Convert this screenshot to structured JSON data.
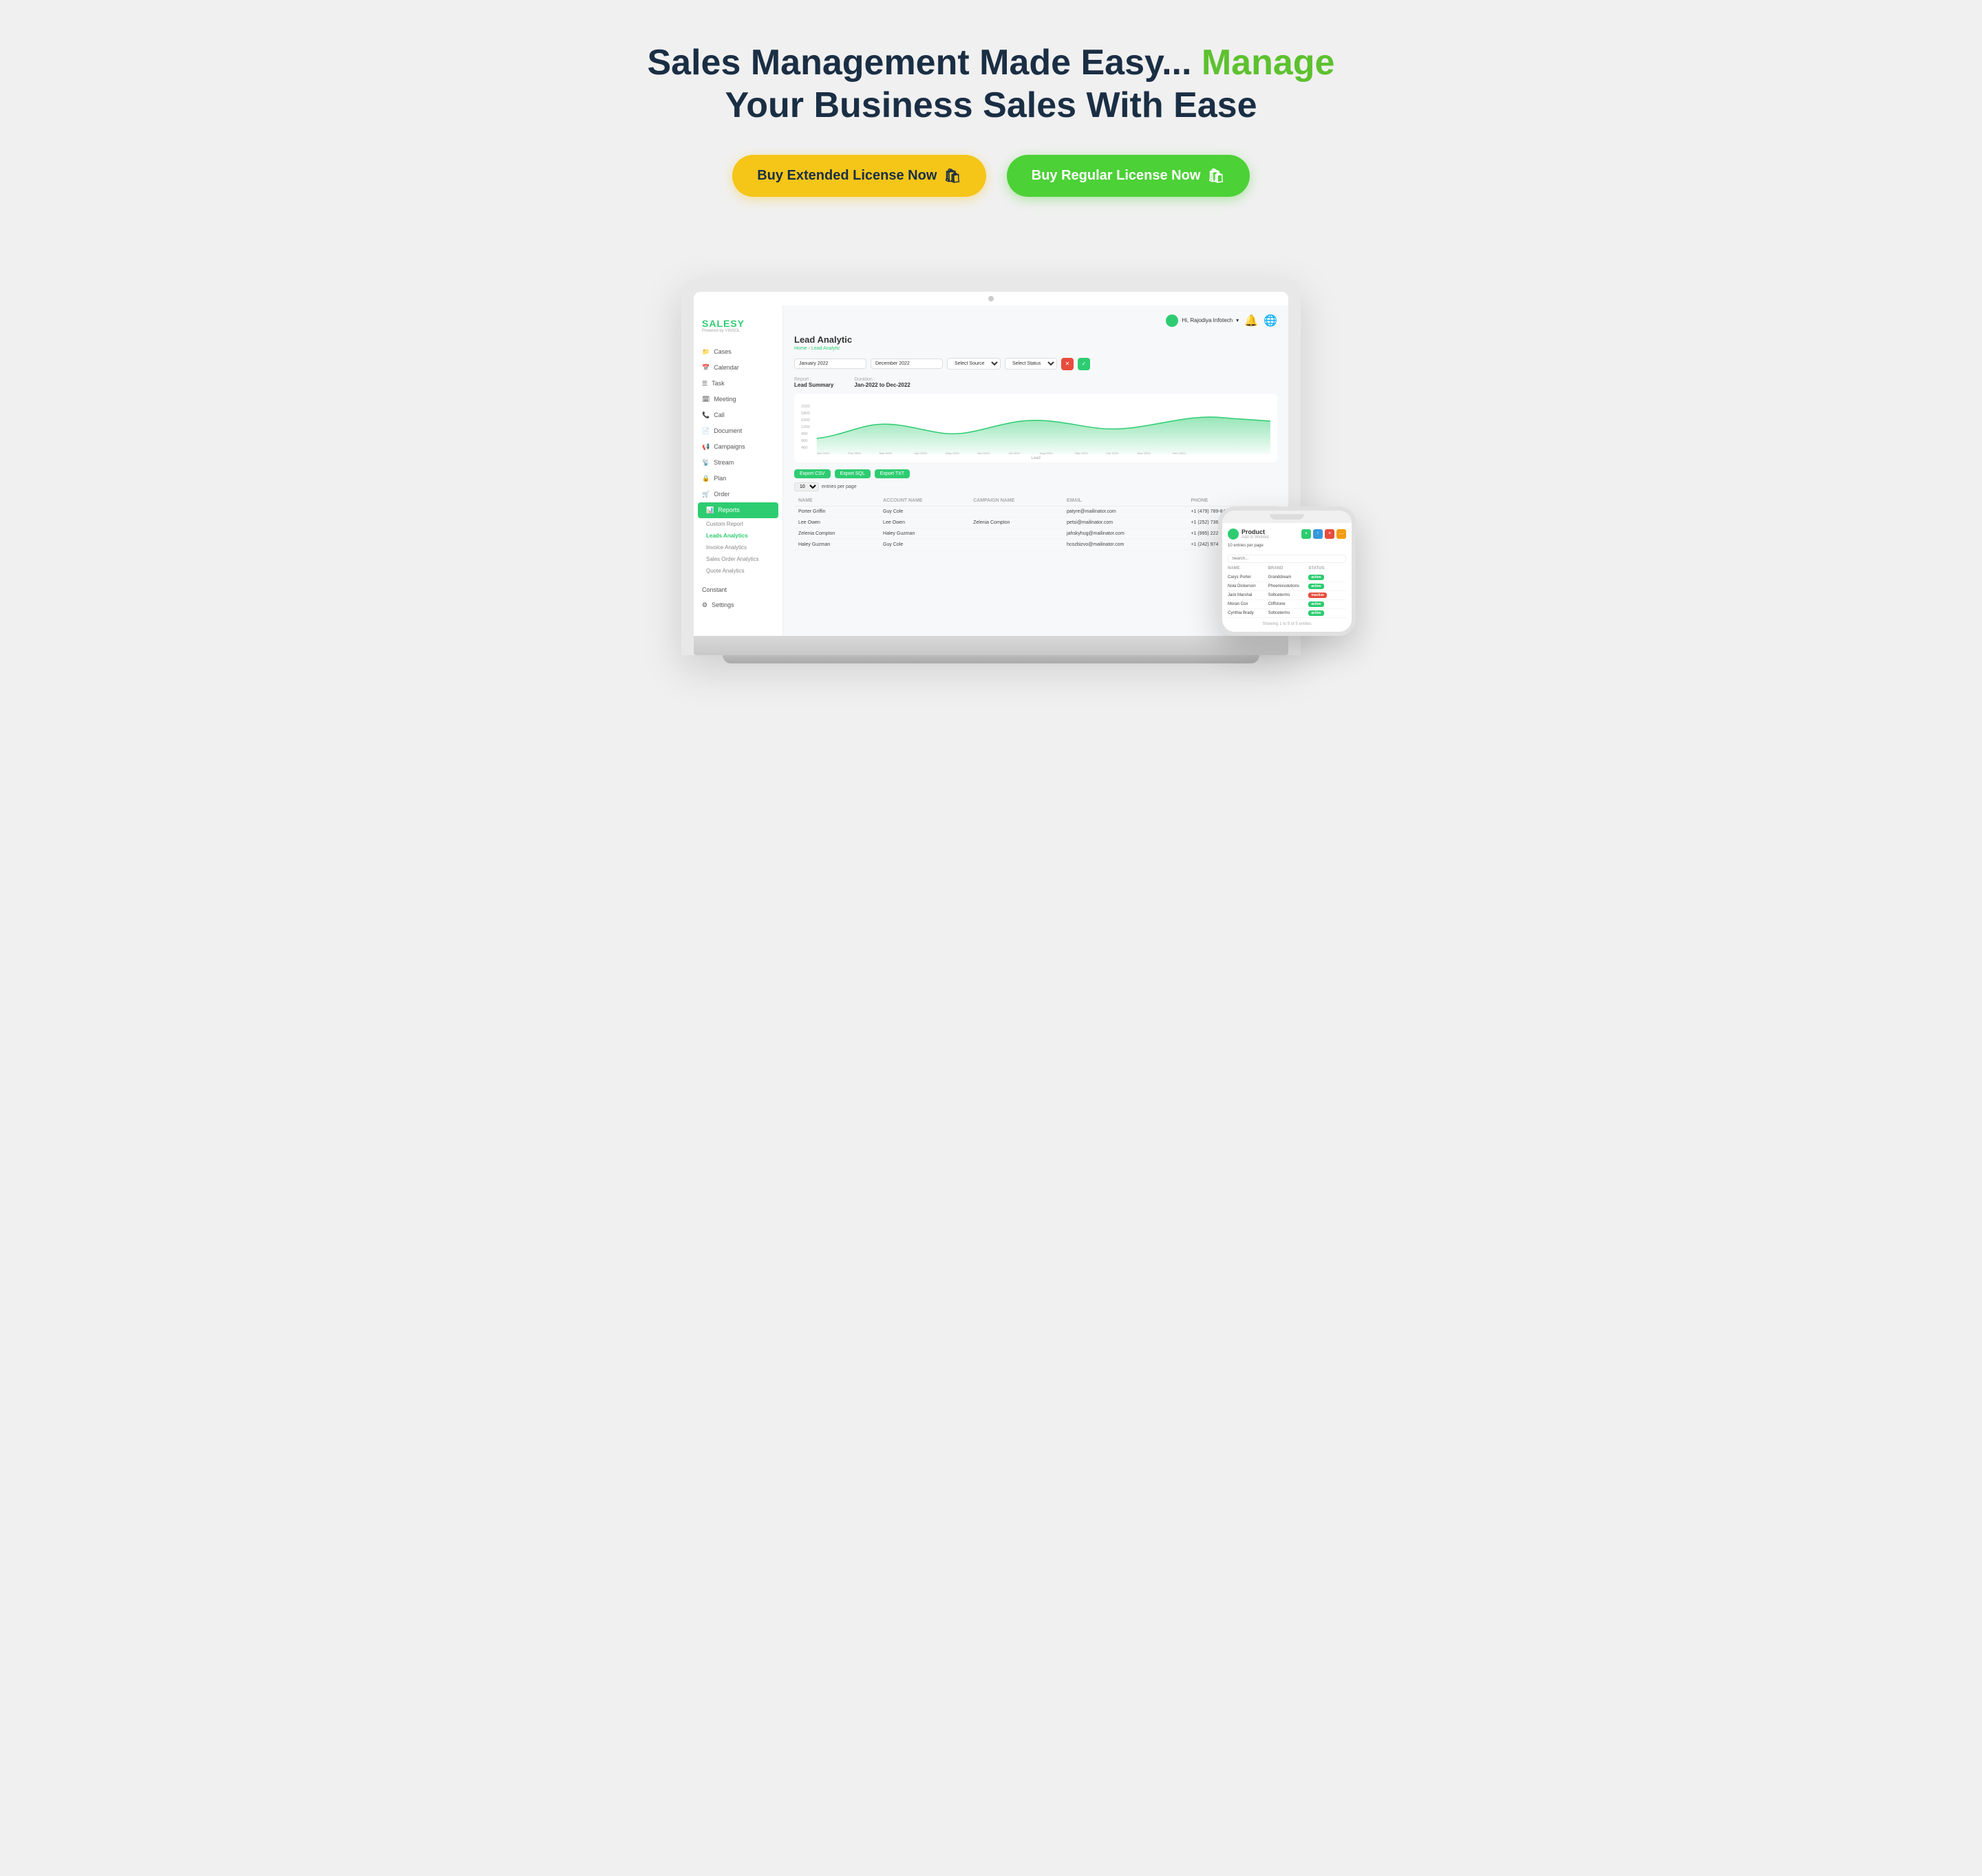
{
  "hero": {
    "title_part1": "Sales Management Made Easy...",
    "title_green": " Manage",
    "title_part2": "Your Business Sales With Ease"
  },
  "buttons": {
    "extended": "Buy Extended License Now",
    "regular": "Buy Regular License Now"
  },
  "laptop": {
    "user": "Hi, Rajodiya Infotech",
    "page_title": "Lead Analytic",
    "breadcrumb_home": "Home",
    "breadcrumb_current": "Lead Analytic",
    "filters": {
      "date_from": "January 2022",
      "date_to": "December 2022",
      "source": "Select Source",
      "status": "Select Status"
    },
    "report": {
      "label": "Report :",
      "value": "Lead Summary",
      "duration_label": "Duration :",
      "duration_value": "Jan-2022 to Dec-2022"
    },
    "chart": {
      "x_labels": [
        "Jan 2021",
        "Feb 2021",
        "Mar 2021",
        "Apr 2021",
        "May 2021",
        "Jun 2021",
        "Jul 2021",
        "Aug 2021",
        "Sep 2021",
        "Oct 2021",
        "Nov 2021",
        "Dec 2021"
      ],
      "y_label": "Lead"
    },
    "exports": [
      "Export CSV",
      "Export SQL",
      "Export TXT"
    ],
    "entries_label": "entries per page",
    "entries_value": "10",
    "table": {
      "columns": [
        "NAME",
        "ACCOUNT NAME",
        "CAMPAIGN NAME",
        "EMAIL",
        "PHONE"
      ],
      "rows": [
        [
          "Porter Griffin",
          "Guy Cole",
          "",
          "patyre@mailinator.com",
          "+1 (479) 789-8427"
        ],
        [
          "Lee Owen",
          "Lee Owen",
          "Zelenia Compton",
          "petsi@mailinator.com",
          "+1 (252) 736-8043"
        ],
        [
          "Zelenia Compton",
          "Haley Guzman",
          "",
          "jahskyhug@mailinator.com",
          "+1 (995) 222-9169"
        ],
        [
          "Haley Guzman",
          "Guy Cole",
          "",
          "hcozbizvo@mailinator.com",
          "+1 (242) 974-2075"
        ]
      ]
    }
  },
  "sidebar": {
    "logo": "SALESY",
    "logo_sub": "Powered by VINSOL",
    "items": [
      {
        "label": "Cases",
        "icon": "📁"
      },
      {
        "label": "Calendar",
        "icon": "📅"
      },
      {
        "label": "Task",
        "icon": "☰"
      },
      {
        "label": "Meeting",
        "icon": "🗓"
      },
      {
        "label": "Call",
        "icon": "📞"
      },
      {
        "label": "Document",
        "icon": "📄"
      },
      {
        "label": "Campaigns",
        "icon": "📢"
      },
      {
        "label": "Stream",
        "icon": "📡"
      },
      {
        "label": "Plan",
        "icon": "🔒"
      },
      {
        "label": "Order",
        "icon": "🛒"
      },
      {
        "label": "Reports",
        "icon": "📊",
        "active": true
      }
    ],
    "sub_items": [
      {
        "label": "Custom Report"
      },
      {
        "label": "Leads Analytics",
        "active": true
      },
      {
        "label": "Invoice Analytics"
      },
      {
        "label": "Sales Order Analytics"
      },
      {
        "label": "Quote Analytics"
      }
    ],
    "bottom": [
      {
        "label": "Constant"
      },
      {
        "label": "Settings"
      }
    ]
  },
  "phone": {
    "title": "Product",
    "sub": "Add to Wishlist",
    "entries": "10  entries per page",
    "search_placeholder": "Search...",
    "columns": [
      "NAME",
      "BRAND",
      "STATUS"
    ],
    "rows": [
      {
        "name": "Carys Porter",
        "brand": "Granddream",
        "status": "active",
        "status_color": "green"
      },
      {
        "name": "Nola Dickerson",
        "brand": "Phoenixsolutions",
        "status": "active",
        "status_color": "green"
      },
      {
        "name": "Jack Marshal",
        "brand": "Soltceterms",
        "status": "inactive",
        "status_color": "red"
      },
      {
        "name": "Moran Cox",
        "brand": "Cliffstone",
        "status": "active",
        "status_color": "green"
      },
      {
        "name": "Cynthia Brady",
        "brand": "Soltceterms",
        "status": "active",
        "status_color": "green"
      }
    ],
    "footer": "Showing 1 to 5 of 5 entries"
  }
}
